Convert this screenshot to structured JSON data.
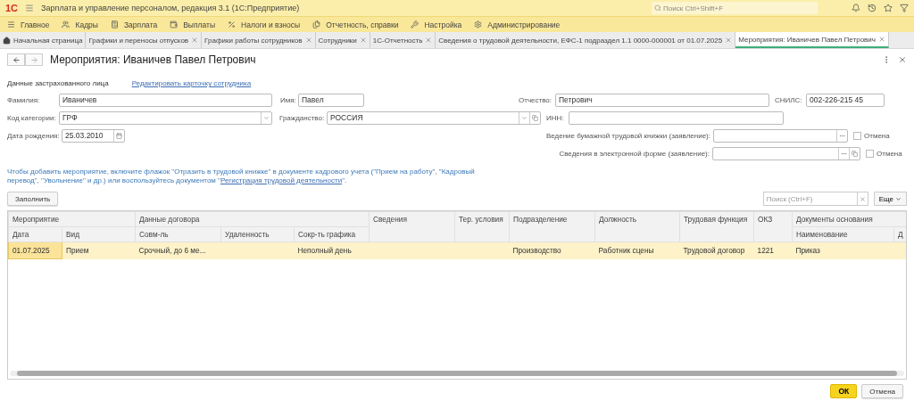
{
  "app": {
    "logo": "1С",
    "title": "Зарплата и управление персоналом, редакция 3.1  (1С:Предприятие)",
    "search_placeholder": "Поиск Ctrl+Shift+F"
  },
  "menu": [
    {
      "label": "Главное"
    },
    {
      "label": "Кадры"
    },
    {
      "label": "Зарплата"
    },
    {
      "label": "Выплаты"
    },
    {
      "label": "Налоги и взносы"
    },
    {
      "label": "Отчетность, справки"
    },
    {
      "label": "Настройка"
    },
    {
      "label": "Администрирование"
    }
  ],
  "tabs": [
    {
      "label": "Начальная страница",
      "kind": "home",
      "selected": false
    },
    {
      "label": "Графики и переносы отпусков",
      "kind": "closable",
      "selected": false
    },
    {
      "label": "Графики работы сотрудников",
      "kind": "closable",
      "selected": false
    },
    {
      "label": "Сотрудники",
      "kind": "closable",
      "selected": false
    },
    {
      "label": "1С-Отчетность",
      "kind": "closable",
      "selected": false
    },
    {
      "label": "Сведения о трудовой деятельности, ЕФС-1 подраздел 1.1 0000-000001 от 01.07.2025",
      "kind": "closable",
      "selected": false
    },
    {
      "label": "Мероприятия: Иваничев Павел Петрович",
      "kind": "closable",
      "selected": true
    }
  ],
  "form": {
    "title": "Мероприятия: Иваничев Павел Петрович",
    "section_label": "Данные застрахованного лица",
    "edit_link": "Редактировать карточку сотрудника",
    "surname": {
      "label": "Фамилия:",
      "value": "Иваничев"
    },
    "name": {
      "label": "Имя:",
      "value": "Павел"
    },
    "patronymic": {
      "label": "Отчество:",
      "value": "Петрович"
    },
    "snils": {
      "label": "СНИЛС:",
      "value": "002-226-215 45"
    },
    "category": {
      "label": "Код категории:",
      "value": "ГРФ"
    },
    "citizenship": {
      "label": "Гражданство:",
      "value": "РОССИЯ"
    },
    "inn": {
      "label": "ИНН:"
    },
    "birth_date": {
      "label": "Дата рождения:",
      "value": "25.03.2010"
    },
    "paper_book": {
      "label": "Ведение бумажной трудовой книжки (заявление):",
      "cancel": {
        "label": "Отмена",
        "checked": false
      }
    },
    "electronic": {
      "label": "Сведения в электронной форме (заявление):",
      "cancel": {
        "label": "Отмена",
        "checked": false
      }
    },
    "info": {
      "text": "Чтобы добавить мероприятие, включите флажок \"Отразить в трудовой книжке\" в документе кадрового учета (\"Прием на работу\", \"Кадровый перевод\", \"Увольнение\" и др.) или воспользуйтесь документом \"",
      "link": "Регистрация трудовой деятельности",
      "text_end": "\"."
    }
  },
  "toolbar": {
    "fill_button": "Заполнить",
    "search_placeholder": "Поиск (Ctrl+F)",
    "more_button": "Еще"
  },
  "table": {
    "header": [
      [
        {
          "label": "Мероприятие",
          "colspan": 2
        },
        {
          "label": "Данные договора",
          "colspan": 3
        },
        {
          "label": "Сведения",
          "rowspan": 2
        },
        {
          "label": "Тер. условия",
          "rowspan": 2
        },
        {
          "label": "Подразделение",
          "rowspan": 2
        },
        {
          "label": "Должность",
          "rowspan": 2
        },
        {
          "label": "Трудовая функция",
          "rowspan": 2
        },
        {
          "label": "ОКЗ",
          "rowspan": 2
        },
        {
          "label": "Документы основания",
          "colspan": 2
        }
      ],
      [
        {
          "label": "Дата"
        },
        {
          "label": "Вид"
        },
        {
          "label": "Совм-ль"
        },
        {
          "label": "Удаленность"
        },
        {
          "label": "Сокр-ть графика"
        },
        {
          "label": "Наименование"
        },
        {
          "label": "Д"
        }
      ]
    ],
    "rows": [
      {
        "selected": true,
        "cells": [
          "01.07.2025",
          "Прием",
          "Срочный, до 6 ме...",
          null,
          "Неполный день",
          null,
          null,
          "Производство",
          "Работник сцены",
          "Трудовой договор",
          "1221",
          "Приказ",
          null
        ]
      }
    ]
  },
  "footer": {
    "ok_button": "ОК",
    "cancel_button": "Отмена"
  }
}
